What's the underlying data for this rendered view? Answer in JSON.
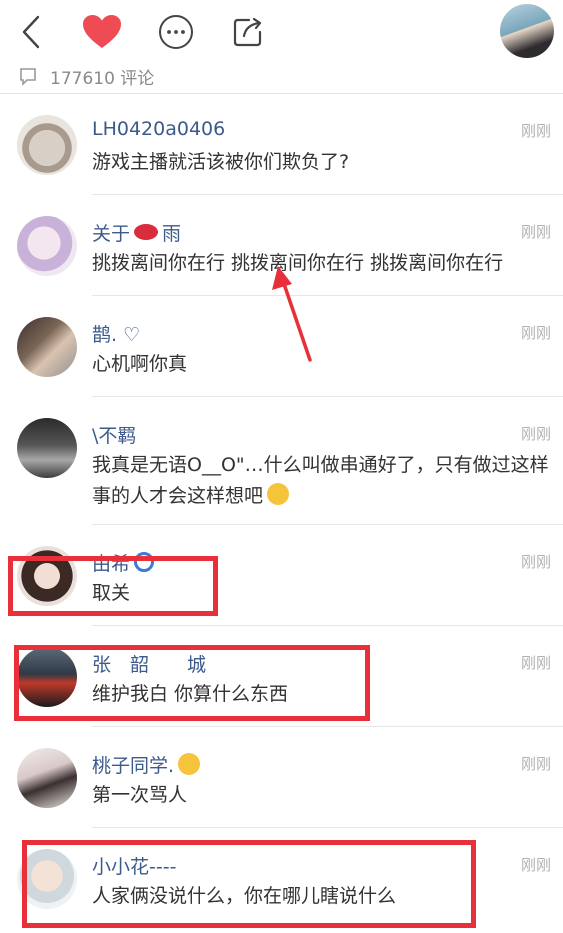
{
  "header": {
    "back_icon": "chevron-left-icon",
    "heart_icon": "heart-icon",
    "heart_color": "#ee4b55",
    "more_icon": "more-icon",
    "share_icon": "share-icon",
    "avatar_icon": "user-avatar"
  },
  "comment_count": "177610 评论",
  "comments": [
    {
      "name": "LH0420a0406",
      "time": "刚刚",
      "text": "游戏主播就活该被你们欺负了?"
    },
    {
      "name_prefix": "关于",
      "name_suffix": "雨",
      "time": "刚刚",
      "text": "挑拨离间你在行 挑拨离间你在行 挑拨离间你在行"
    },
    {
      "name": "鹊. ♡",
      "time": "刚刚",
      "text": "心机啊你真"
    },
    {
      "name": "\\不羁",
      "time": "刚刚",
      "text": "我真是无语O__O\"…什么叫做串通好了，只有做过这样事的人才会这样想吧"
    },
    {
      "name": "由希",
      "time": "刚刚",
      "text": "取关"
    },
    {
      "name": "张　韶　　城",
      "time": "刚刚",
      "text": "维护我白  你算什么东西"
    },
    {
      "name": "桃子同学.",
      "time": "刚刚",
      "text": "第一次骂人"
    },
    {
      "name": "小小花----",
      "time": "刚刚",
      "text": "人家俩没说什么，你在哪儿瞎说什么"
    }
  ],
  "annotation_color": "#e8303a"
}
